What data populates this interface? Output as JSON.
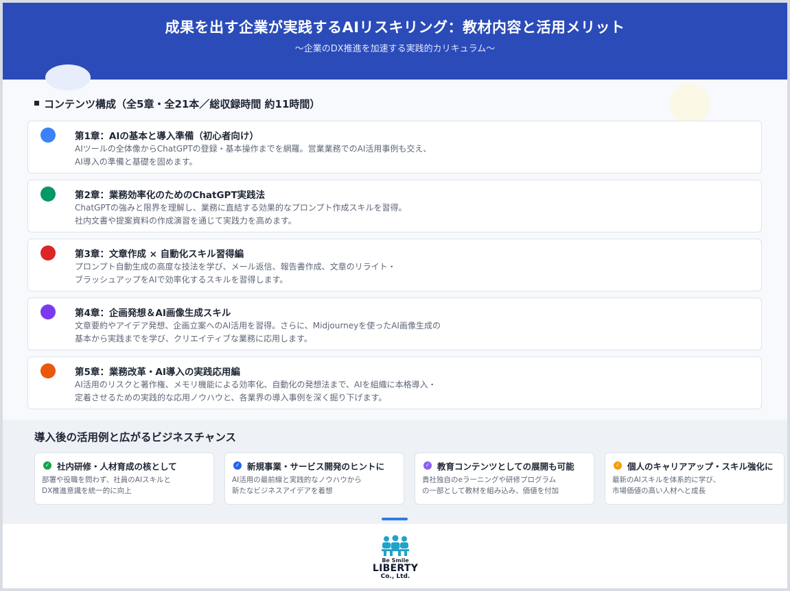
{
  "header": {
    "title": "成果を出す企業が実践するAIリスキリング：教材内容と活用メリット",
    "subtitle": "〜企業のDX推進を加速する実践的カリキュラム〜"
  },
  "contents": {
    "section_title": "コンテンツ構成（全5章・全21本／総収録時間 約11時間）",
    "chapters": [
      {
        "title": "第1章：AIの基本と導入準備（初心者向け）",
        "desc_line1": "AIツールの全体像からChatGPTの登録・基本操作までを網羅。営業業務でのAI活用事例も交え、",
        "desc_line2": "AI導入の準備と基礎を固めます。",
        "color": "#3b82f6"
      },
      {
        "title": "第2章：業務効率化のためのChatGPT実践法",
        "desc_line1": "ChatGPTの強みと限界を理解し、業務に直結する効果的なプロンプト作成スキルを習得。",
        "desc_line2": "社内文書や提案資料の作成演習を通じて実践力を高めます。",
        "color": "#059669"
      },
      {
        "title": "第3章：文章作成 × 自動化スキル習得編",
        "desc_line1": "プロンプト自動生成の高度な技法を学び、メール返信、報告書作成、文章のリライト・",
        "desc_line2": "ブラッシュアップをAIで効率化するスキルを習得します。",
        "color": "#dc2626"
      },
      {
        "title": "第4章：企画発想＆AI画像生成スキル",
        "desc_line1": "文章要約やアイデア発想、企画立案へのAI活用を習得。さらに、Midjourneyを使ったAI画像生成の",
        "desc_line2": "基本から実践までを学び、クリエイティブな業務に応用します。",
        "color": "#7c3aed"
      },
      {
        "title": "第5章：業務改革・AI導入の実践応用編",
        "desc_line1": "AI活用のリスクと著作権、メモリ機能による効率化、自動化の発想法まで、AIを組織に本格導入・",
        "desc_line2": "定着させるための実践的な応用ノウハウと、各業界の導入事例を深く掘り下げます。",
        "color": "#ea580c"
      }
    ]
  },
  "usecases": {
    "title": "導入後の活用例と広がるビジネスチャンス",
    "cards": [
      {
        "title": "社内研修・人材育成の核として",
        "desc_line1": "部署や役職を問わず、社員のAIスキルと",
        "desc_line2": "DX推進意識を統一的に向上",
        "color": "#16a34a"
      },
      {
        "title": "新規事業・サービス開発のヒントに",
        "desc_line1": "AI活用の最前線と実践的なノウハウから",
        "desc_line2": "新たなビジネスアイデアを着想",
        "color": "#2563eb"
      },
      {
        "title": "教育コンテンツとしての展開も可能",
        "desc_line1": "貴社独自のeラーニングや研修プログラム",
        "desc_line2": "の一部として教材を組み込み、価値を付加",
        "color": "#8b5cf6"
      },
      {
        "title": "個人のキャリアアップ・スキル強化に",
        "desc_line1": "最新のAIスキルを体系的に学び、",
        "desc_line2": "市場価値の高い人材へと成長",
        "color": "#f59e0b"
      }
    ]
  },
  "logo": {
    "tagline": "Be Smile",
    "brand": "LIBERTY",
    "company_suffix": "Co., Ltd.",
    "icon": "people-group-icon",
    "color": "#1fa3c9"
  }
}
